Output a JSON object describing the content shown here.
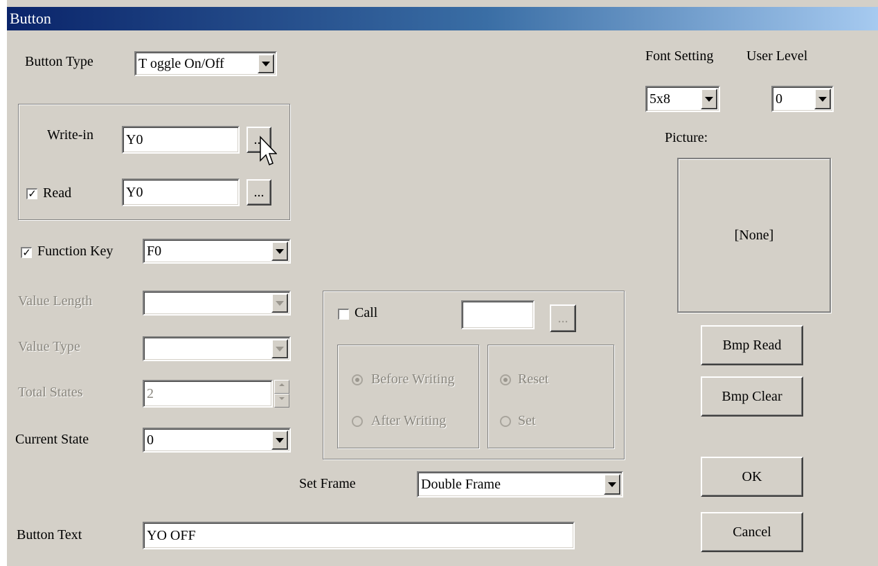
{
  "window": {
    "title": "Button"
  },
  "button_type": {
    "label": "Button Type",
    "value": "T oggle On/Off"
  },
  "write_in": {
    "label": "Write-in",
    "value": "Y0",
    "browse": "..."
  },
  "read": {
    "label": "Read",
    "checked": true,
    "value": "Y0",
    "browse": "..."
  },
  "function_key": {
    "label": "Function Key",
    "checked": true,
    "value": "F0"
  },
  "value_length": {
    "label": "Value Length",
    "value": ""
  },
  "value_type": {
    "label": "Value Type",
    "value": ""
  },
  "total_states": {
    "label": "Total States",
    "value": "2"
  },
  "current_state": {
    "label": "Current State",
    "value": "0"
  },
  "call": {
    "label": "Call",
    "checked": false,
    "value": "",
    "browse": "..."
  },
  "write_timing": {
    "before": "Before Writing",
    "after": "After Writing"
  },
  "reset_set": {
    "reset": "Reset",
    "set": "Set"
  },
  "set_frame": {
    "label": "Set Frame",
    "value": "Double Frame"
  },
  "button_text": {
    "label": "Button Text",
    "value": "YO OFF"
  },
  "font_setting": {
    "label": "Font Setting",
    "value": "5x8"
  },
  "user_level": {
    "label": "User Level",
    "value": "0"
  },
  "picture": {
    "label": "Picture:",
    "value": "[None]"
  },
  "actions": {
    "bmp_read": "Bmp Read",
    "bmp_clear": "Bmp Clear",
    "ok": "OK",
    "cancel": "Cancel"
  },
  "colors": {
    "dialog_bg": "#d4d0c8",
    "title_start": "#0a246a",
    "title_end": "#a6caf0",
    "disabled_text": "#8a877f"
  }
}
